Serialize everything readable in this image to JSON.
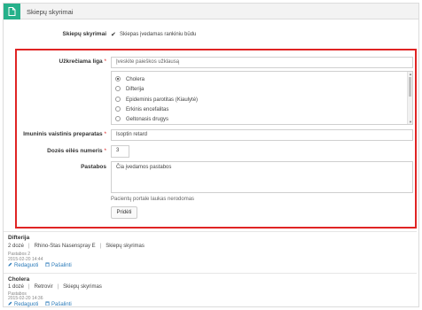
{
  "header": {
    "title": "Skiepų skyrimai"
  },
  "form": {
    "manual_label": "Skiepų skyrimai",
    "manual_checkbox_label": "Skiepas įvedamas rankiniu būdu",
    "disease_label": "Užkrečiama liga",
    "required_mark": "*",
    "disease_search_placeholder": "Įveskite paieškos užklausą",
    "disease_options": [
      "Cholera",
      "Difterija",
      "Epideminis parotitas (Kiaulytė)",
      "Erkinis encefalitas",
      "Geltonasis drugys"
    ],
    "disease_selected_index": 0,
    "drug_label": "Imuninis vaistinis preparatas",
    "drug_value": "Isoptin retard",
    "dose_label": "Dozės eilės numeris",
    "dose_value": "3",
    "notes_label": "Pastabos",
    "notes_value": "Čia įvedamos pastabos",
    "notes_hint": "Pacientų portale laukas nerodomas",
    "add_button": "Pridėti"
  },
  "records": [
    {
      "disease": "Difterija",
      "dose": "2 dozė",
      "drug": "Rhino-Stas Nasenspray E",
      "type": "Skiepų skyrimas",
      "note": "Pastabos 2",
      "date": "2015-02-20 14:44",
      "edit_label": "Redaguoti",
      "delete_label": "Pašalinti"
    },
    {
      "disease": "Cholera",
      "dose": "1 dozė",
      "drug": "Retrovir",
      "type": "Skiepų skyrimas",
      "note": "Pastabos",
      "date": "2015-02-20 14:36",
      "edit_label": "Redaguoti",
      "delete_label": "Pašalinti"
    }
  ],
  "colors": {
    "accent": "#27b18b",
    "highlight_border": "#e02424",
    "link": "#2a7ab9"
  }
}
